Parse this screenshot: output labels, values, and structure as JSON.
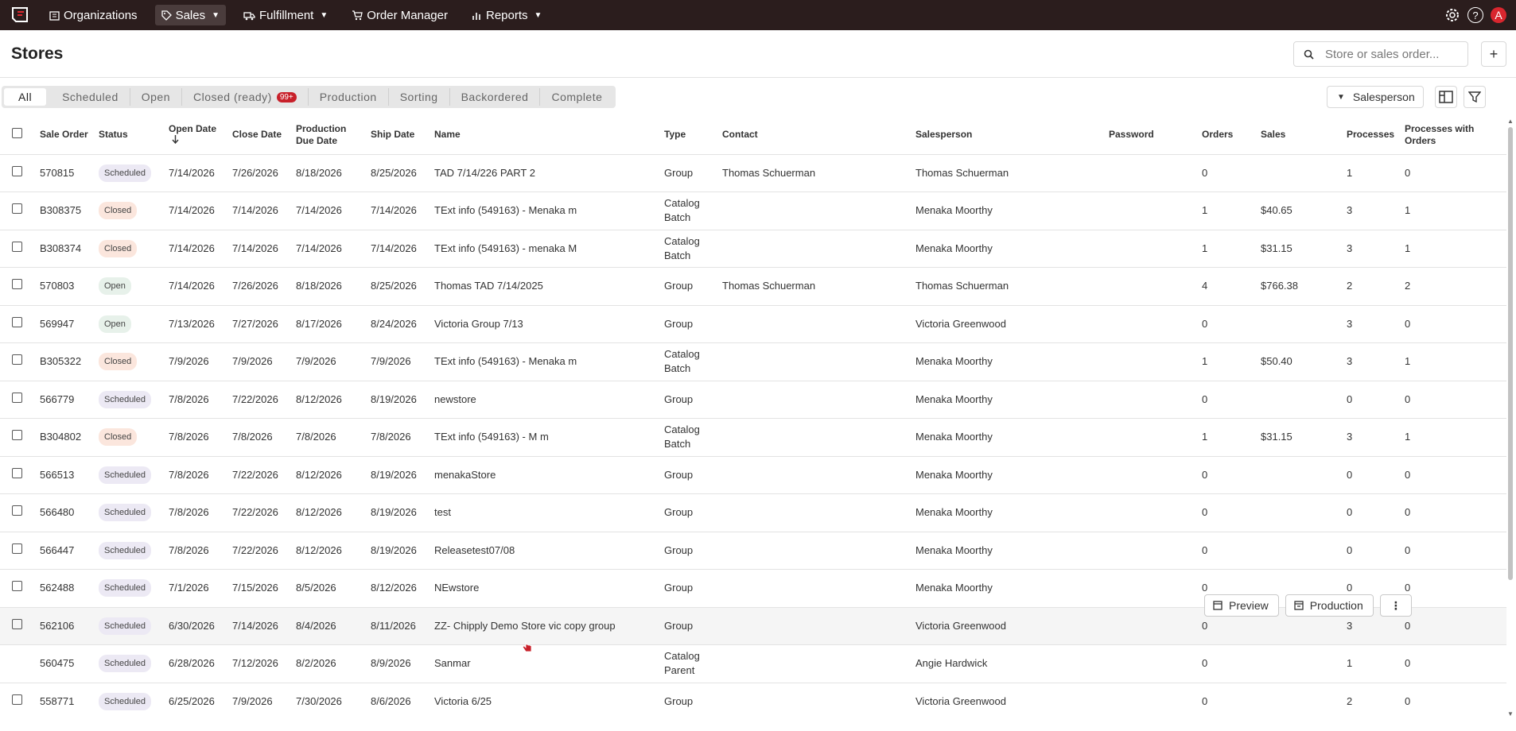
{
  "nav": {
    "items": [
      {
        "label": "Organizations",
        "icon": "building-icon",
        "dropdown": false,
        "active": false
      },
      {
        "label": "Sales",
        "icon": "tag-icon",
        "dropdown": true,
        "active": true
      },
      {
        "label": "Fulfillment",
        "icon": "truck-icon",
        "dropdown": true,
        "active": false
      },
      {
        "label": "Order Manager",
        "icon": "cart-icon",
        "dropdown": false,
        "active": false
      },
      {
        "label": "Reports",
        "icon": "chart-icon",
        "dropdown": true,
        "active": false
      }
    ],
    "avatar_letter": "A"
  },
  "page": {
    "title": "Stores",
    "search_placeholder": "Store or sales order..."
  },
  "tabs": [
    {
      "label": "All",
      "active": true
    },
    {
      "label": "Scheduled"
    },
    {
      "label": "Open"
    },
    {
      "label": "Closed (ready)",
      "badge": "99+"
    },
    {
      "label": "Production"
    },
    {
      "label": "Sorting"
    },
    {
      "label": "Backordered"
    },
    {
      "label": "Complete"
    }
  ],
  "toolbar": {
    "salesperson_label": "Salesperson"
  },
  "columns": [
    "Sale Order",
    "Status",
    "Open Date",
    "Close Date",
    "Production Due Date",
    "Ship Date",
    "Name",
    "Type",
    "Contact",
    "Salesperson",
    "Password",
    "Orders",
    "Sales",
    "Processes",
    "Processes with Orders"
  ],
  "rows": [
    {
      "order": "570815",
      "status": "Scheduled",
      "open": "7/14/2026",
      "close": "7/26/2026",
      "due": "8/18/2026",
      "ship": "8/25/2026",
      "name": "TAD 7/14/226 PART 2",
      "type": "Group",
      "contact": "Thomas Schuerman",
      "salesperson": "Thomas Schuerman",
      "orders": "0",
      "sales": "",
      "processes": "1",
      "pwo": "0",
      "checkbox": true
    },
    {
      "order": "B308375",
      "status": "Closed",
      "open": "7/14/2026",
      "close": "7/14/2026",
      "due": "7/14/2026",
      "ship": "7/14/2026",
      "name": "TExt info (549163) - Menaka m",
      "type": "Catalog Batch",
      "contact": "",
      "salesperson": "Menaka Moorthy",
      "orders": "1",
      "sales": "$40.65",
      "processes": "3",
      "pwo": "1",
      "checkbox": true
    },
    {
      "order": "B308374",
      "status": "Closed",
      "open": "7/14/2026",
      "close": "7/14/2026",
      "due": "7/14/2026",
      "ship": "7/14/2026",
      "name": "TExt info (549163) - menaka M",
      "type": "Catalog Batch",
      "contact": "",
      "salesperson": "Menaka Moorthy",
      "orders": "1",
      "sales": "$31.15",
      "processes": "3",
      "pwo": "1",
      "checkbox": true
    },
    {
      "order": "570803",
      "status": "Open",
      "open": "7/14/2026",
      "close": "7/26/2026",
      "due": "8/18/2026",
      "ship": "8/25/2026",
      "name": "Thomas TAD 7/14/2025",
      "type": "Group",
      "contact": "Thomas Schuerman",
      "salesperson": "Thomas Schuerman",
      "orders": "4",
      "sales": "$766.38",
      "processes": "2",
      "pwo": "2",
      "checkbox": true
    },
    {
      "order": "569947",
      "status": "Open",
      "open": "7/13/2026",
      "close": "7/27/2026",
      "due": "8/17/2026",
      "ship": "8/24/2026",
      "name": "Victoria Group 7/13",
      "type": "Group",
      "contact": "",
      "salesperson": "Victoria Greenwood",
      "orders": "0",
      "sales": "",
      "processes": "3",
      "pwo": "0",
      "checkbox": true
    },
    {
      "order": "B305322",
      "status": "Closed",
      "open": "7/9/2026",
      "close": "7/9/2026",
      "due": "7/9/2026",
      "ship": "7/9/2026",
      "name": "TExt info (549163) - Menaka m",
      "type": "Catalog Batch",
      "contact": "",
      "salesperson": "Menaka Moorthy",
      "orders": "1",
      "sales": "$50.40",
      "processes": "3",
      "pwo": "1",
      "checkbox": true
    },
    {
      "order": "566779",
      "status": "Scheduled",
      "open": "7/8/2026",
      "close": "7/22/2026",
      "due": "8/12/2026",
      "ship": "8/19/2026",
      "name": "newstore",
      "type": "Group",
      "contact": "",
      "salesperson": "Menaka Moorthy",
      "orders": "0",
      "sales": "",
      "processes": "0",
      "pwo": "0",
      "checkbox": true
    },
    {
      "order": "B304802",
      "status": "Closed",
      "open": "7/8/2026",
      "close": "7/8/2026",
      "due": "7/8/2026",
      "ship": "7/8/2026",
      "name": "TExt info (549163) - M m",
      "type": "Catalog Batch",
      "contact": "",
      "salesperson": "Menaka Moorthy",
      "orders": "1",
      "sales": "$31.15",
      "processes": "3",
      "pwo": "1",
      "checkbox": true
    },
    {
      "order": "566513",
      "status": "Scheduled",
      "open": "7/8/2026",
      "close": "7/22/2026",
      "due": "8/12/2026",
      "ship": "8/19/2026",
      "name": "menakaStore",
      "type": "Group",
      "contact": "",
      "salesperson": "Menaka Moorthy",
      "orders": "0",
      "sales": "",
      "processes": "0",
      "pwo": "0",
      "checkbox": true
    },
    {
      "order": "566480",
      "status": "Scheduled",
      "open": "7/8/2026",
      "close": "7/22/2026",
      "due": "8/12/2026",
      "ship": "8/19/2026",
      "name": "test",
      "type": "Group",
      "contact": "",
      "salesperson": "Menaka Moorthy",
      "orders": "0",
      "sales": "",
      "processes": "0",
      "pwo": "0",
      "checkbox": true
    },
    {
      "order": "566447",
      "status": "Scheduled",
      "open": "7/8/2026",
      "close": "7/22/2026",
      "due": "8/12/2026",
      "ship": "8/19/2026",
      "name": "Releasetest07/08",
      "type": "Group",
      "contact": "",
      "salesperson": "Menaka Moorthy",
      "orders": "0",
      "sales": "",
      "processes": "0",
      "pwo": "0",
      "checkbox": true
    },
    {
      "order": "562488",
      "status": "Scheduled",
      "open": "7/1/2026",
      "close": "7/15/2026",
      "due": "8/5/2026",
      "ship": "8/12/2026",
      "name": "NEwstore",
      "type": "Group",
      "contact": "",
      "salesperson": "Menaka Moorthy",
      "orders": "0",
      "sales": "",
      "processes": "0",
      "pwo": "0",
      "checkbox": true
    },
    {
      "order": "562106",
      "status": "Scheduled",
      "open": "6/30/2026",
      "close": "7/14/2026",
      "due": "8/4/2026",
      "ship": "8/11/2026",
      "name": "ZZ- Chipply Demo Store vic copy group",
      "type": "Group",
      "contact": "",
      "salesperson": "Victoria Greenwood",
      "orders": "0",
      "sales": "",
      "processes": "3",
      "pwo": "0",
      "checkbox": true,
      "hover": true
    },
    {
      "order": "560475",
      "status": "Scheduled",
      "open": "6/28/2026",
      "close": "7/12/2026",
      "due": "8/2/2026",
      "ship": "8/9/2026",
      "name": "Sanmar",
      "type": "Catalog Parent",
      "contact": "",
      "salesperson": "Angie Hardwick",
      "orders": "0",
      "sales": "",
      "processes": "1",
      "pwo": "0",
      "checkbox": false
    },
    {
      "order": "558771",
      "status": "Scheduled",
      "open": "6/25/2026",
      "close": "7/9/2026",
      "due": "7/30/2026",
      "ship": "8/6/2026",
      "name": "Victoria 6/25",
      "type": "Group",
      "contact": "",
      "salesperson": "Victoria Greenwood",
      "orders": "0",
      "sales": "",
      "processes": "2",
      "pwo": "0",
      "checkbox": true
    }
  ],
  "row_actions": {
    "preview_label": "Preview",
    "production_label": "Production"
  },
  "colors": {
    "topbar": "#2b1d1d",
    "accent": "#c8202a",
    "scheduled": "#ece9f4",
    "closed": "#fbe6dd",
    "open": "#e7f1ea"
  }
}
